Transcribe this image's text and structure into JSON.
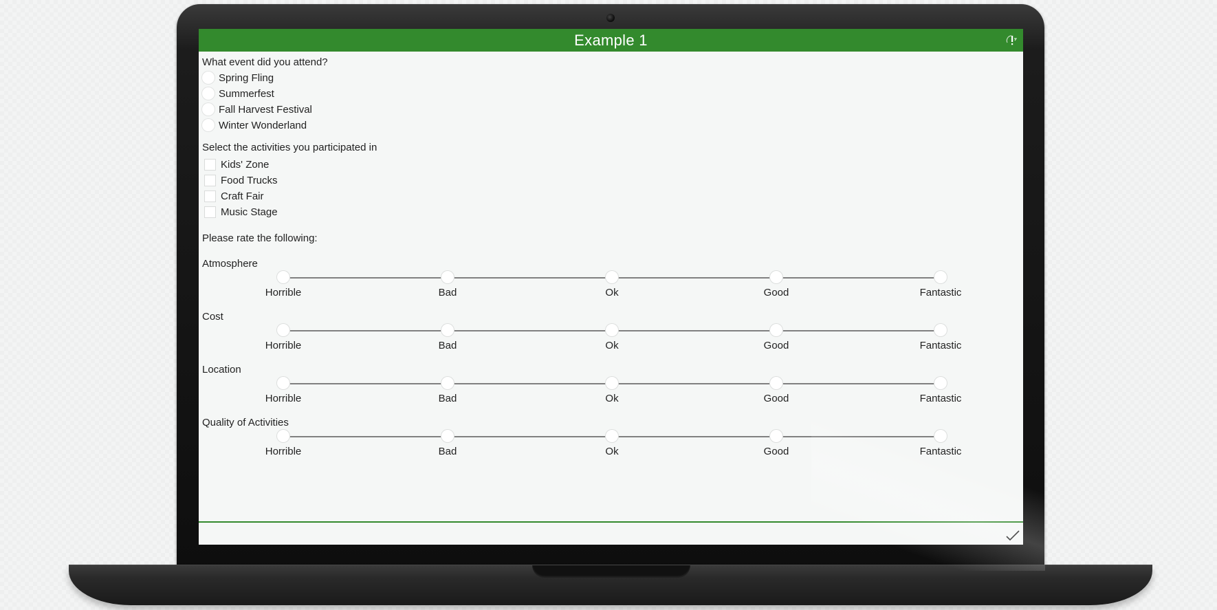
{
  "app": {
    "title": "Example 1"
  },
  "q1": {
    "label": "What event did you attend?",
    "options": [
      "Spring Fling",
      "Summerfest",
      "Fall Harvest Festival",
      "Winter Wonderland"
    ]
  },
  "q2": {
    "label": "Select the activities you participated in",
    "options": [
      "Kids' Zone",
      "Food Trucks",
      "Craft Fair",
      "Music Stage"
    ]
  },
  "ratings": {
    "heading": "Please rate the following:",
    "scale_labels": [
      "Horrible",
      "Bad",
      "Ok",
      "Good",
      "Fantastic"
    ],
    "items": [
      "Atmosphere",
      "Cost",
      "Location",
      "Quality of Activities"
    ]
  },
  "icons": {
    "header_right": "alert-icon",
    "footer_right": "checkmark-icon"
  },
  "colors": {
    "accent": "#338a2d",
    "background": "#f5f7f6"
  }
}
